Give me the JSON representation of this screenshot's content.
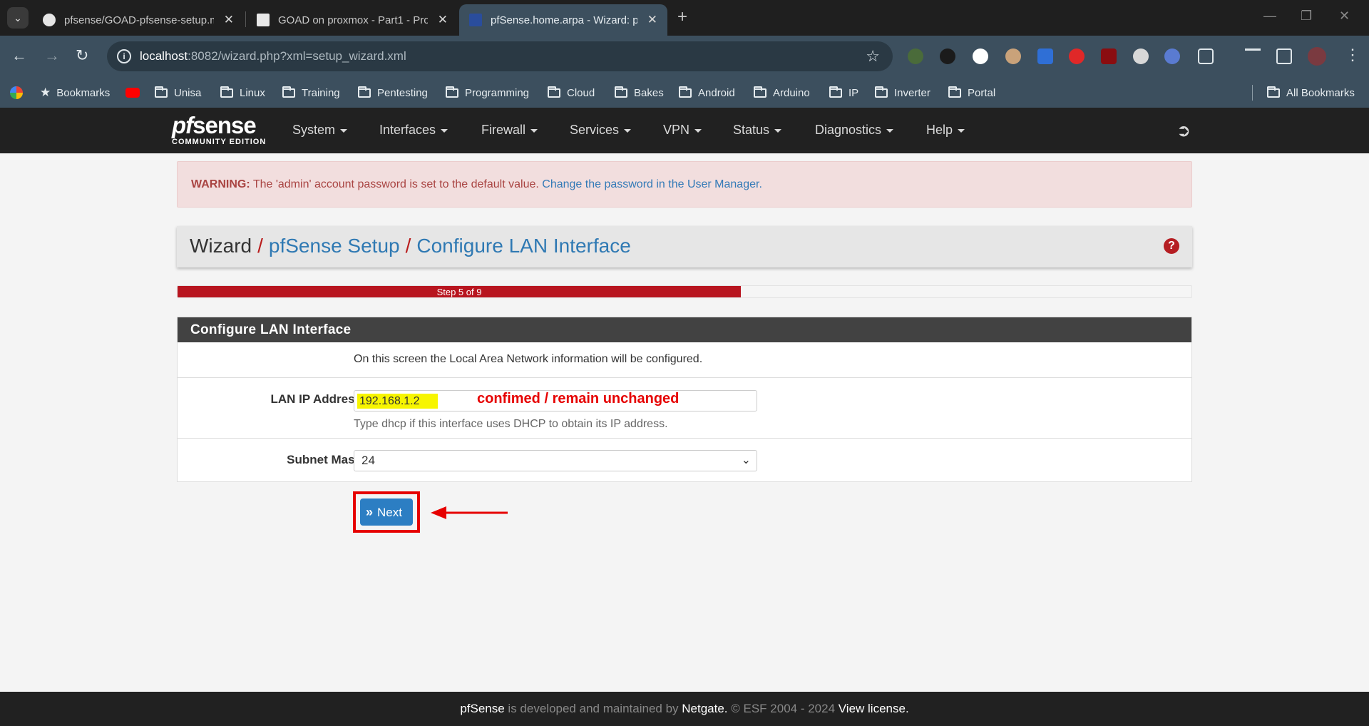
{
  "browser": {
    "tabs": [
      {
        "title": "pfsense/GOAD-pfsense-setup.m",
        "icon": "github-icon",
        "active": false
      },
      {
        "title": "GOAD on proxmox - Part1 - Pro",
        "icon": "page-icon",
        "active": false
      },
      {
        "title": "pfSense.home.arpa - Wizard: pf",
        "icon": "pfsense-favicon",
        "active": true
      }
    ],
    "url_host": "localhost",
    "url_rest": ":8082/wizard.php?xml=setup_wizard.xml",
    "bookmarks": [
      "Bookmarks",
      "Unisa",
      "Linux",
      "Training",
      "Pentesting",
      "Programming",
      "Cloud",
      "Bakes",
      "Android",
      "Arduino",
      "IP",
      "Inverter",
      "Portal"
    ],
    "all_bookmarks": "All Bookmarks"
  },
  "navbar": {
    "logo_main_1": "pf",
    "logo_main_2": "sense",
    "logo_sub": "COMMUNITY EDITION",
    "menus": [
      "System",
      "Interfaces",
      "Firewall",
      "Services",
      "VPN",
      "Status",
      "Diagnostics",
      "Help"
    ]
  },
  "warning": {
    "label": "WARNING:",
    "text": " The 'admin' account password is set to the default value. ",
    "link": "Change the password in the User Manager."
  },
  "breadcrumb": {
    "root": "Wizard",
    "sep": "/",
    "level1": "pfSense Setup",
    "level2": "Configure LAN Interface"
  },
  "progress": {
    "label": "Step 5 of 9",
    "fraction": 0.5556
  },
  "panel": {
    "title": "Configure LAN Interface",
    "intro": "On this screen the Local Area Network information will be configured.",
    "lan_ip_label": "LAN IP Address",
    "lan_ip_value": "192.168.1.2",
    "lan_ip_hint": "Type dhcp if this interface uses DHCP to obtain its IP address.",
    "subnet_label": "Subnet Mask",
    "subnet_value": "24"
  },
  "annotation": "confimed / remain unchanged",
  "next_button": "Next",
  "footer": {
    "brand": "pfSense",
    "mid": " is developed and maintained by ",
    "company": "Netgate.",
    "copy": " © ESF 2004 - 2024 ",
    "license": "View license."
  },
  "colors": {
    "navbar_bg": "#212121",
    "progress_fill": "#b8151f",
    "button_blue": "#2c7ec3",
    "annotation_red": "#e60000",
    "warning_bg": "#f2dede"
  }
}
